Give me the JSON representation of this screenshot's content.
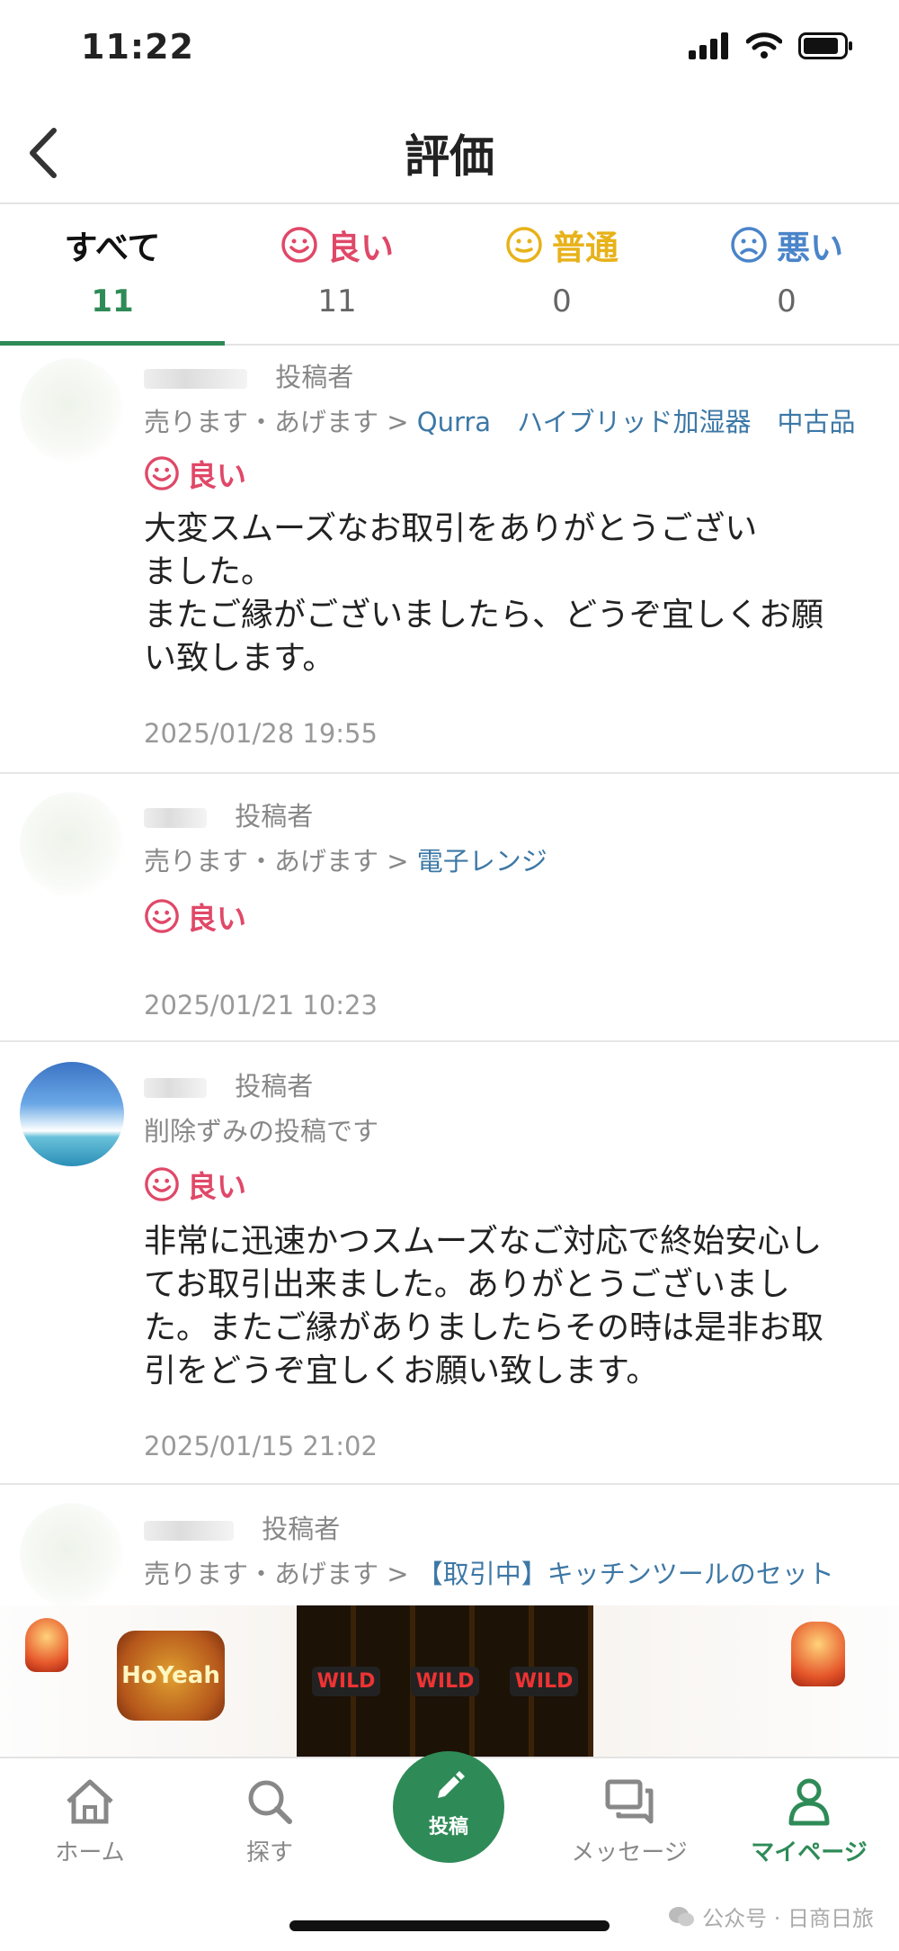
{
  "status_bar": {
    "time": "11:22"
  },
  "header": {
    "title": "評価"
  },
  "tabs": [
    {
      "label": "すべて",
      "count": "11"
    },
    {
      "label": "良い",
      "count": "11"
    },
    {
      "label": "普通",
      "count": "0"
    },
    {
      "label": "悪い",
      "count": "0"
    }
  ],
  "colors": {
    "accent": "#2e8b57",
    "good": "#e04868",
    "normal": "#e7b21a",
    "bad": "#4a84c9",
    "link": "#3d78a6"
  },
  "reviews": [
    {
      "role": "投稿者",
      "path_prefix": "売ります・あげます >",
      "path_link": "Qurra　ハイブリッド加湿器　中古品",
      "rating": "良い",
      "text_lines": [
        "大変スムーズなお取引をありがとうござい",
        "ました。",
        "またご縁がございましたら、どうぞ宜しくお願",
        "い致します。"
      ],
      "date": "2025/01/28 19:55"
    },
    {
      "role": "投稿者",
      "path_prefix": "売ります・あげます >",
      "path_link": "電子レンジ",
      "rating": "良い",
      "date": "2025/01/21 10:23"
    },
    {
      "role": "投稿者",
      "path_prefix": "削除ずみの投稿です",
      "rating": "良い",
      "text_lines": [
        "非常に迅速かつスムーズなご対応で終始安心し",
        "てお取引出来ました。ありがとうございまし",
        "た。またご縁がありましたらその時は是非お取",
        "引をどうぞ宜しくお願い致します。"
      ],
      "date": "2025/01/15 21:02"
    },
    {
      "role": "投稿者",
      "path_prefix": "売ります・あげます >",
      "path_link": "【取引中】キッチンツールのセット"
    }
  ],
  "ad": {
    "logo_text": "HoYeah",
    "reel_text": "WILD"
  },
  "bottom_nav": {
    "home": "ホーム",
    "search": "探す",
    "post": "投稿",
    "messages": "メッセージ",
    "mypage": "マイページ"
  },
  "watermark": "公众号 · 日商日旅"
}
